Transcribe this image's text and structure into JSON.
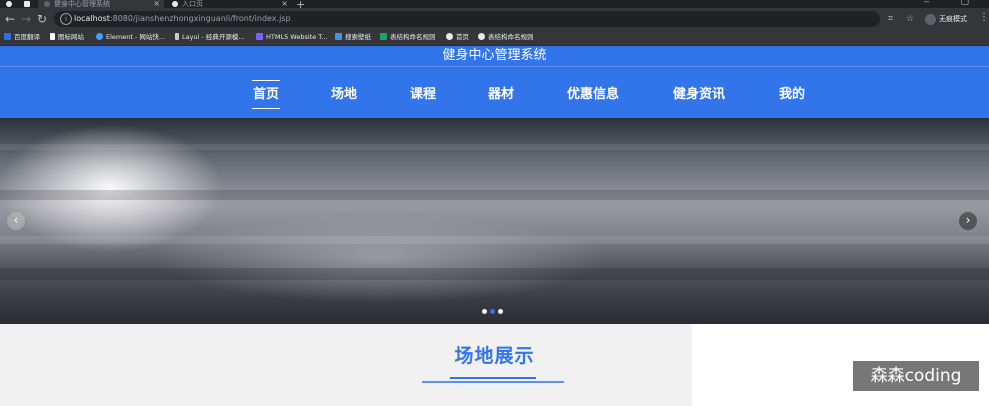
{
  "browser": {
    "tabs": [
      {
        "title": "健身中心管理系统"
      },
      {
        "title": "入口页"
      }
    ],
    "new_tab": "+",
    "window_controls": "‒ ▢",
    "url_host": "localhost",
    "url_rest": ":8080/jianshenzhongxinguanli/front/index.jsp",
    "profile_label": "无痕模式",
    "bookmarks": [
      {
        "label": "百度翻译",
        "icon": "baidu-translate-icon",
        "color": "#2f6fe4"
      },
      {
        "label": "图标网站",
        "icon": "flag-icon",
        "color": "#ffffff"
      },
      {
        "label": "Element - 网站快...",
        "icon": "element-icon",
        "color": "#409eff"
      },
      {
        "label": "Layui - 经典开源模...",
        "icon": "layui-icon",
        "color": "#cccccc"
      },
      {
        "label": "HTML5 Website T...",
        "icon": "html5-icon",
        "color": "#7b61ff"
      },
      {
        "label": "搜索壁纸",
        "icon": "wallpaper-icon",
        "color": "#4a90e2"
      },
      {
        "label": "表结构命名规则",
        "icon": "sheet-icon",
        "color": "#21a366"
      },
      {
        "label": "首页",
        "icon": "globe-icon",
        "color": "#e8eaed"
      },
      {
        "label": "表结构命名规则",
        "icon": "globe-icon",
        "color": "#e8eaed"
      }
    ]
  },
  "site": {
    "title": "健身中心管理系统",
    "brand_color": "#3274ea",
    "nav": [
      {
        "label": "首页",
        "active": true
      },
      {
        "label": "场地"
      },
      {
        "label": "课程"
      },
      {
        "label": "器材"
      },
      {
        "label": "优惠信息"
      },
      {
        "label": "健身资讯"
      },
      {
        "label": "我的"
      }
    ]
  },
  "carousel": {
    "prev_icon": "‹",
    "next_icon": "›",
    "slide_count": 3,
    "active_index": 1
  },
  "section": {
    "title": "场地展示"
  },
  "watermark": {
    "text": "森森coding"
  }
}
